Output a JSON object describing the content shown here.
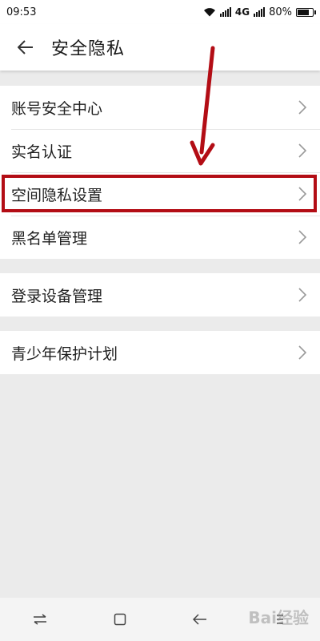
{
  "status_bar": {
    "time": "09:53",
    "network": "4G",
    "battery_text": "80%",
    "battery_level": 0.8
  },
  "header": {
    "back_icon": "arrow-left-icon",
    "title": "安全隐私"
  },
  "groups": [
    {
      "items": [
        {
          "label": "账号安全中心",
          "icon": "chevron-right-icon"
        },
        {
          "label": "实名认证",
          "icon": "chevron-right-icon"
        },
        {
          "label": "空间隐私设置",
          "icon": "chevron-right-icon"
        },
        {
          "label": "黑名单管理",
          "icon": "chevron-right-icon"
        }
      ]
    },
    {
      "items": [
        {
          "label": "登录设备管理",
          "icon": "chevron-right-icon"
        }
      ]
    },
    {
      "items": [
        {
          "label": "青少年保护计划",
          "icon": "chevron-right-icon"
        }
      ]
    }
  ],
  "annotation": {
    "highlight_color": "#b30d15",
    "highlighted_item": "空间隐私设置"
  },
  "nav_bar": {
    "buttons": [
      "switch-icon",
      "home-icon",
      "back-icon",
      "menu-icon"
    ]
  },
  "watermark": {
    "text": "Bai经验"
  }
}
